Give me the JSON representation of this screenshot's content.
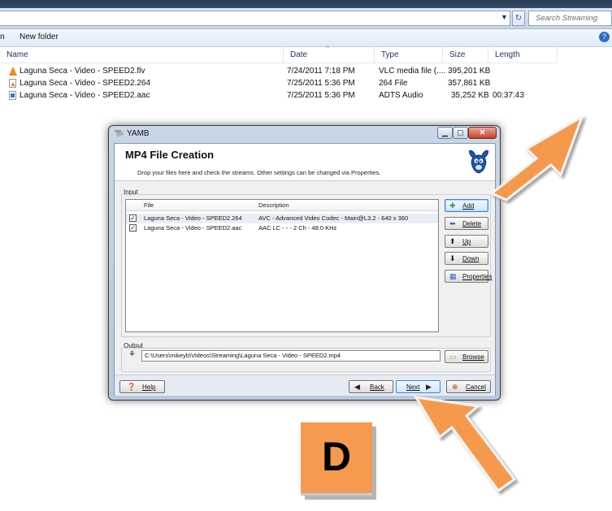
{
  "explorer": {
    "search_placeholder": "Search Streaming",
    "organize_tail": "n",
    "new_folder": "New folder",
    "columns": {
      "name": "Name",
      "date": "Date",
      "type": "Type",
      "size": "Size",
      "length": "Length"
    },
    "files": [
      {
        "name": "Laguna Seca - Video - SPEED2.flv",
        "date": "7/24/2011 7:18 PM",
        "type": "VLC media file (....",
        "size": "395,201 KB",
        "length": "",
        "icon": "vlc-cone-icon"
      },
      {
        "name": "Laguna Seca - Video - SPEED2.264",
        "date": "7/25/2011 5:36 PM",
        "type": "264 File",
        "size": "357,861 KB",
        "length": "",
        "icon": "vlc-file-icon"
      },
      {
        "name": "Laguna Seca - Video - SPEED2.aac",
        "date": "7/25/2011 5:36 PM",
        "type": "ADTS Audio",
        "size": "35,252 KB",
        "length": "00:37:43",
        "icon": "audio-file-icon"
      }
    ]
  },
  "dialog": {
    "window_title": "YAMB",
    "header_title": "MP4 File Creation",
    "header_subtitle": "Drop your files here and check the streams. Other settings can be changed via Properties.",
    "input_label": "Input",
    "list_columns": {
      "file": "File",
      "description": "Description"
    },
    "streams": [
      {
        "file": "Laguna Seca - Video - SPEED2.264",
        "description": "AVC - Advanced Video Codec - Main@L3.2 - 640 x 360",
        "checked": true
      },
      {
        "file": "Laguna Seca - Video - SPEED2.aac",
        "description": "AAC LC -  -  - 2 Ch - 48.0 KHz",
        "checked": true
      }
    ],
    "side_buttons": {
      "add": "Add",
      "delete": "Delete",
      "up": "Up",
      "down": "Down",
      "properties": "Properties"
    },
    "output_label": "Output",
    "output_path": "C:\\Users\\mikeyb\\Videos\\Streaming\\Laguna Seca - Video - SPEED2.mp4",
    "browse": "Browse",
    "footer": {
      "help": "Help",
      "back": "Back",
      "next": "Next",
      "cancel": "Cancel"
    }
  },
  "annotation": {
    "step_letter": "D",
    "arrow_color": "#f59a4e",
    "badge_color": "#f59a4e"
  }
}
